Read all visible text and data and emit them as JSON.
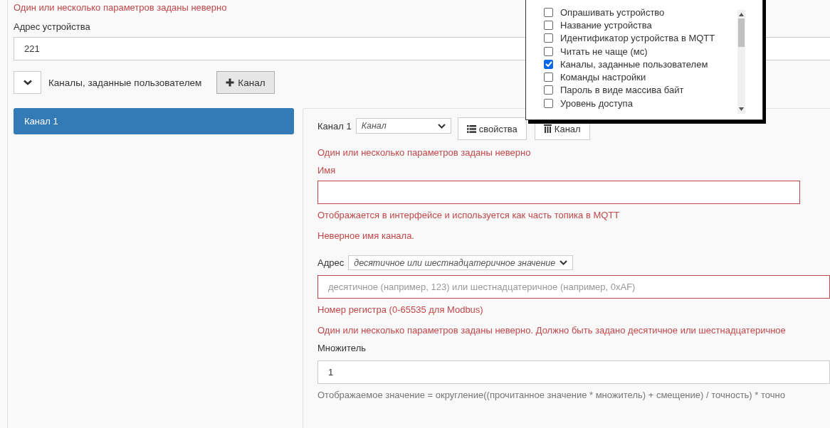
{
  "form_error": "Один или несколько параметров заданы неверно",
  "device_address": {
    "label": "Адрес устройства",
    "value": "221"
  },
  "channels_section": {
    "expanded": true,
    "title": "Каналы, заданные пользователем",
    "add_button": "Канал"
  },
  "channel_list": [
    {
      "label": "Канал 1",
      "selected": true
    }
  ],
  "channel_editor": {
    "name_label": "Канал 1",
    "type_select": "Канал",
    "properties_button": "свойства",
    "delete_button": "Канал",
    "error": "Один или несколько параметров заданы неверно",
    "fields": [
      {
        "kind": "text",
        "label": "Имя",
        "invalid": true,
        "help": "Отображается в интерфейсе и используется как часть топика в MQTT",
        "error": "Неверное имя канала."
      },
      {
        "kind": "select-text",
        "label": "Адрес",
        "select": "десятичное или шестнадцатеричное значение",
        "placeholder": "десятичное (например, 123) или шестнадцатеричное (например, 0xAF)",
        "invalid": true,
        "help": "Номер регистра (0-65535 для Modbus)",
        "error": "Один или несколько параметров заданы неверно. Должно быть задано десятичное или шестнадцатеричное"
      },
      {
        "kind": "text",
        "label": "Множитель",
        "value": "1",
        "invalid": false,
        "help": "Отображаемое значение = округление((прочитанное значение * множитель) + смещение) / точность) * точно"
      }
    ]
  },
  "properties_popup": {
    "options": [
      {
        "label": "Опрашивать устройство",
        "checked": false
      },
      {
        "label": "Название устройства",
        "checked": false
      },
      {
        "label": "Идентификатор устройства в MQTT",
        "checked": false
      },
      {
        "label": "Читать не чаще (мс)",
        "checked": false
      },
      {
        "label": "Каналы, заданные пользователем",
        "checked": true
      },
      {
        "label": "Команды настройки",
        "checked": false
      },
      {
        "label": "Пароль в виде массива байт",
        "checked": false
      },
      {
        "label": "Уровень доступа",
        "checked": false
      }
    ]
  }
}
